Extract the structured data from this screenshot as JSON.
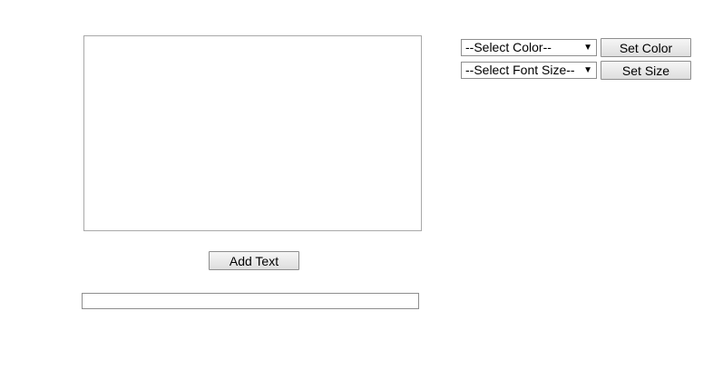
{
  "canvas": {},
  "add_text_button": {
    "label": "Add Text"
  },
  "text_input": {
    "value": "",
    "placeholder": ""
  },
  "color_select": {
    "selected": "--Select Color--"
  },
  "set_color_button": {
    "label": "Set Color"
  },
  "size_select": {
    "selected": "--Select Font Size--"
  },
  "set_size_button": {
    "label": "Set Size"
  },
  "icons": {
    "dropdown": "triangle-down-icon"
  }
}
